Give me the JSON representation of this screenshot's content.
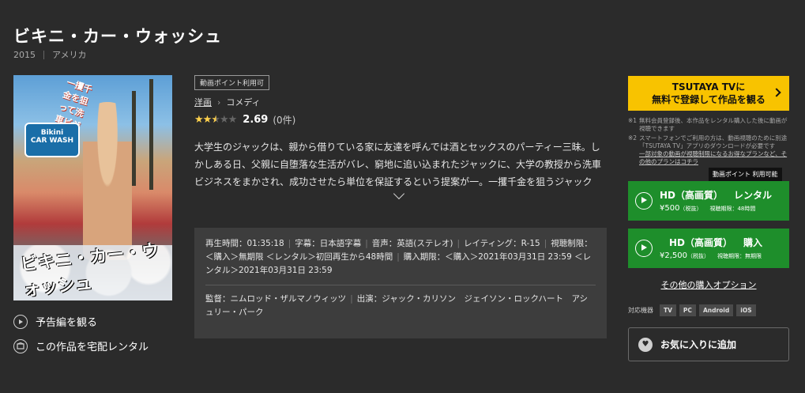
{
  "title": "ビキニ・カー・ウォッシュ",
  "meta": {
    "year": "2015",
    "country": "アメリカ"
  },
  "poster": {
    "side_text": "一攫千金を狙って洗車ビジネス!?",
    "logo_line1": "Bikini",
    "logo_line2": "CAR WASH",
    "jp_title": "ビキニ・カー・ウォッシュ"
  },
  "left_actions": {
    "trailer": "予告編を観る",
    "rental": "この作品を宅配レンタル"
  },
  "point_badge": "動画ポイント利用可",
  "genre": {
    "primary": "洋画",
    "secondary": "コメディ"
  },
  "rating": {
    "value": 2.69,
    "score_text": "2.69",
    "count": "(0件)"
  },
  "description": "大学生のジャックは、親から借りている家に友達を呼んでは酒とセックスのパーティー三昧。しかしある日、父親に自堕落な生活がバレ、窮地に追い込まれたジャックに、大学の教授から洗車ビジネスをまかされ、成功させたら単位を保証するという提案が一。一攫千金を狙うジャックは、ビキ",
  "info": {
    "runtime": "再生時間：01:35:18",
    "subtitles": "字幕：日本語字幕",
    "audio": "音声：英語(ステレオ)",
    "rating": "レイティング：R-15",
    "viewing_limit": "視聴制限：＜購入＞無期限 ＜レンタル＞初回再生から48時間",
    "purchase_limit": "購入期限：＜購入＞2021年03月31日 23:59 ＜レンタル＞2021年03月31日 23:59",
    "director": "監督：ニムロッド・ザルマノウィッツ",
    "cast": "出演：ジャック・カリソン　ジェイソン・ロックハート　アシュリー・パーク"
  },
  "cta": {
    "line1": "TSUTAYA TVに",
    "line2": "無料で登録して作品を観る"
  },
  "notes": {
    "n1_key": "※1",
    "n1": "無料会員登録後、本作品をレンタル購入した後に動画が視聴できます",
    "n2_key": "※2",
    "n2": "スマートフォンでご利用の方は、動画視聴のために別途「TSUTAYA TV」アプリのダウンロードが必要です",
    "n2_link": "一部対象の動画が視聴制限になるお得なプランなど、その他のプランはコチラ"
  },
  "tooltip": "動画ポイント 利用可能",
  "offers": [
    {
      "quality": "HD（高画質）",
      "type": "レンタル",
      "price": "¥500",
      "tax": "（税抜）",
      "limit": "視聴期限：48時間"
    },
    {
      "quality": "HD（高画質）",
      "type": "購入",
      "price": "¥2,500",
      "tax": "（税抜）",
      "limit": "視聴期限：無期限"
    }
  ],
  "other_options": "その他の購入オプション",
  "devices": {
    "label": "対応機器",
    "list": [
      "TV",
      "PC",
      "Android",
      "iOS"
    ]
  },
  "favorite": "お気に入りに追加",
  "colors": {
    "background": "#2b2b2b",
    "cta": "#f8c300",
    "buy": "#1e8e2b",
    "star": "#ffd24d"
  }
}
